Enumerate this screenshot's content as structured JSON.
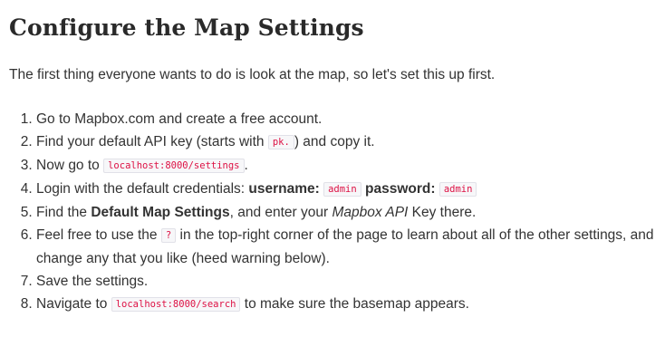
{
  "heading": "Configure the Map Settings",
  "intro": "The first thing everyone wants to do is look at the map, so let's set this up first.",
  "steps": {
    "s1": {
      "text": "Go to Mapbox.com and create a free account."
    },
    "s2": {
      "a": "Find your default API key (starts with ",
      "code": "pk.",
      "b": ") and copy it."
    },
    "s3": {
      "a": "Now go to ",
      "code": "localhost:8000/settings",
      "b": "."
    },
    "s4": {
      "a": "Login with the default credentials: ",
      "user_label": "username:",
      "user_code": "admin",
      "pass_label": "password:",
      "pass_code": "admin"
    },
    "s5": {
      "a": "Find the ",
      "strong": "Default Map Settings",
      "b": ", and enter your ",
      "em": "Mapbox API",
      "c": " Key there."
    },
    "s6": {
      "a": "Feel free to use the ",
      "code": "?",
      "b": " in the top-right corner of the page to learn about all of the other settings, and change any that you like (heed warning below)."
    },
    "s7": {
      "text": "Save the settings."
    },
    "s8": {
      "a": "Navigate to ",
      "code": "localhost:8000/search",
      "b": " to make sure the basemap appears."
    }
  }
}
